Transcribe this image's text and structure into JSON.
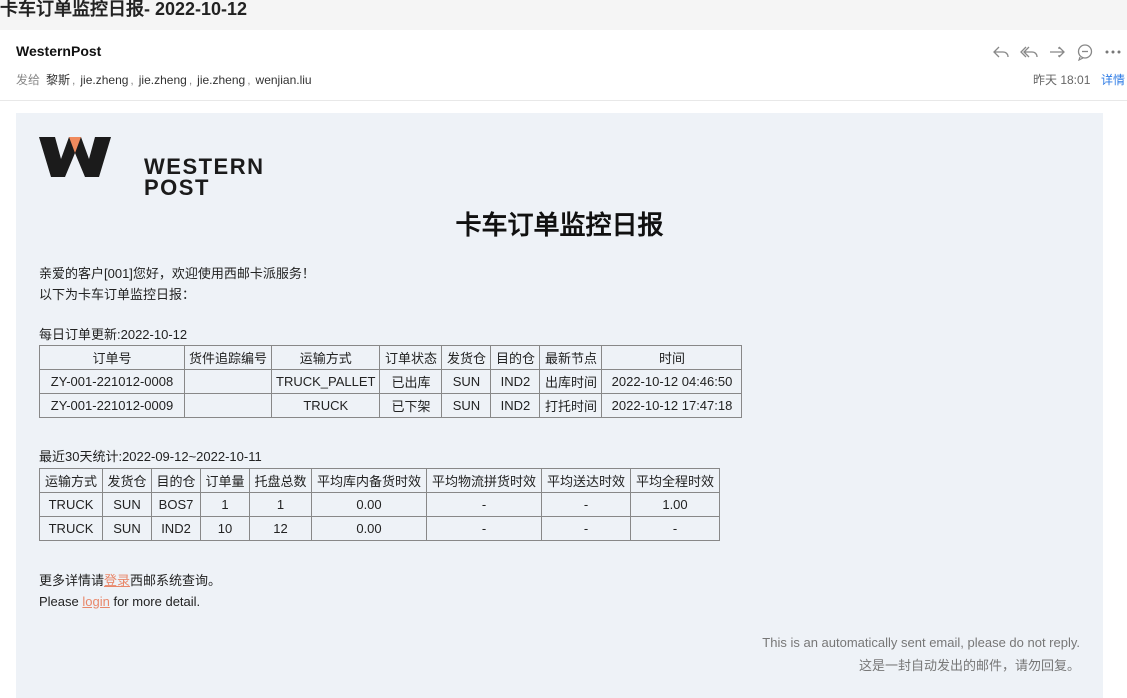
{
  "subject": "卡车订单监控日报- 2022-10-12",
  "header": {
    "sender": "WesternPost",
    "to_label": "发给",
    "recipients": [
      "黎斯",
      "jie.zheng",
      "jie.zheng",
      "jie.zheng",
      "wenjian.liu"
    ],
    "time": "昨天 18:01",
    "detail_label": "详情",
    "actions": [
      "reply-icon",
      "reply-all-icon",
      "forward-icon",
      "comment-icon",
      "more-icon"
    ]
  },
  "email": {
    "logo_line1": "WESTERN",
    "logo_line2": "POST",
    "title": "卡车订单监控日报",
    "greeting1": "亲爱的客户[001]您好，欢迎使用西邮卡派服务！",
    "greeting2": "以下为卡车订单监控日报：",
    "daily_label": "每日订单更新:2022-10-12",
    "daily_table": {
      "headers": [
        "订单号",
        "货件追踪编号",
        "运输方式",
        "订单状态",
        "发货仓",
        "目的仓",
        "最新节点",
        "时间"
      ],
      "rows": [
        [
          "ZY-001-221012-0008",
          "",
          "TRUCK_PALLET",
          "已出库",
          "SUN",
          "IND2",
          "出库时间",
          "2022-10-12 04:46:50"
        ],
        [
          "ZY-001-221012-0009",
          "",
          "TRUCK",
          "已下架",
          "SUN",
          "IND2",
          "打托时间",
          "2022-10-12 17:47:18"
        ]
      ]
    },
    "stats_label": "最近30天统计:2022-09-12~2022-10-11",
    "stats_table": {
      "headers": [
        "运输方式",
        "发货仓",
        "目的仓",
        "订单量",
        "托盘总数",
        "平均库内备货时效",
        "平均物流拼货时效",
        "平均送达时效",
        "平均全程时效"
      ],
      "rows": [
        [
          "TRUCK",
          "SUN",
          "BOS7",
          "1",
          "1",
          "0.00",
          "-",
          "-",
          "1.00"
        ],
        [
          "TRUCK",
          "SUN",
          "IND2",
          "10",
          "12",
          "0.00",
          "-",
          "-",
          "-"
        ]
      ]
    },
    "more_cn_pre": "更多详情请",
    "more_cn_link": "登录",
    "more_cn_post": "西邮系统查询。",
    "more_en_pre": "Please ",
    "more_en_link": "login",
    "more_en_post": " for more detail.",
    "footer_en": "This is an automatically sent email, please do not reply.",
    "footer_cn": "这是一封自动发出的邮件，请勿回复。"
  },
  "colors": {
    "card_bg": "#eef2f7",
    "link": "#e8876a",
    "accent_blue": "#2d7be5",
    "logo_orange": "#f08a5d",
    "logo_dark": "#1b1b1b"
  }
}
